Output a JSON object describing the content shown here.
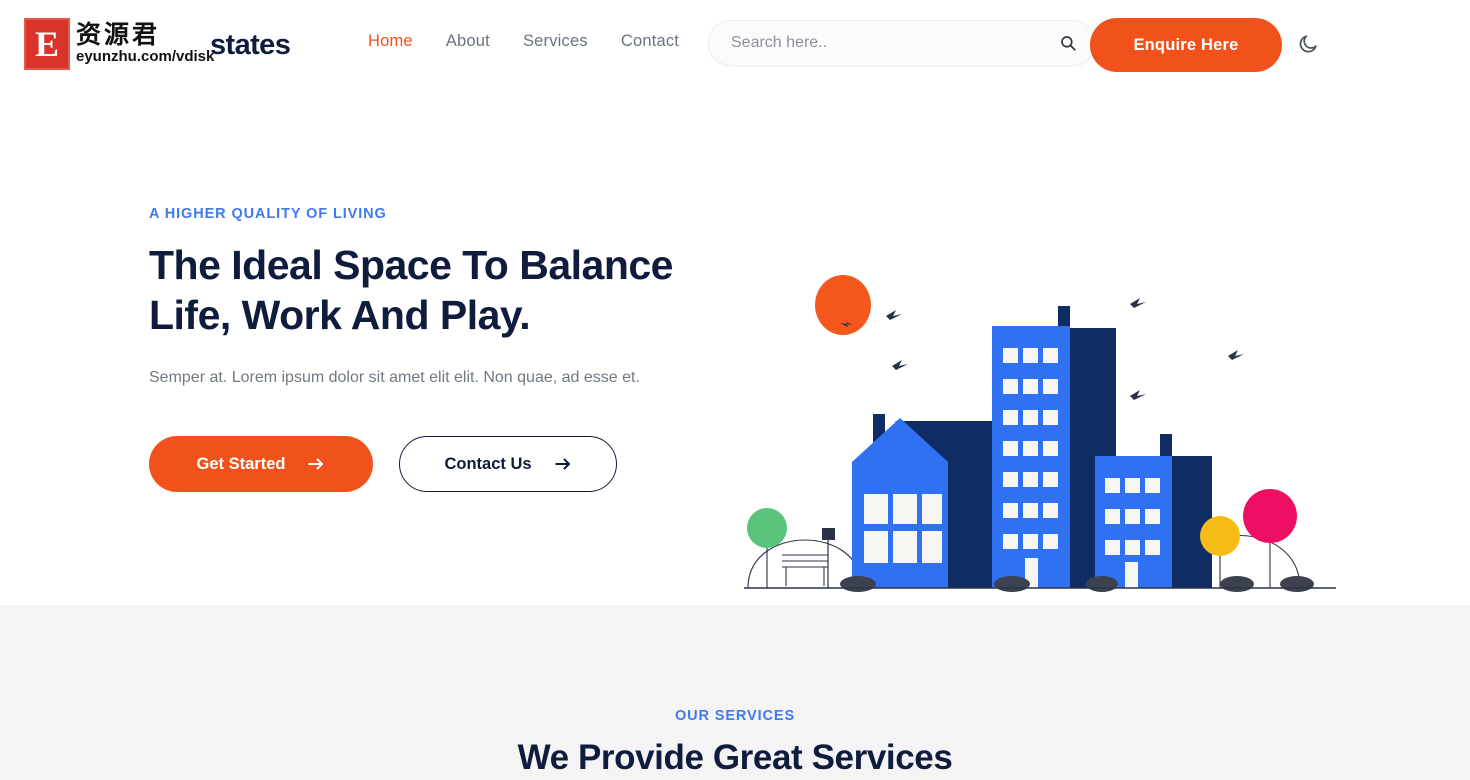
{
  "header": {
    "watermark": {
      "letter": "E",
      "chinese": "资源君",
      "url": "eyunzhu.com/vdisk"
    },
    "logo_text": "states",
    "nav": [
      {
        "label": "Home",
        "active": true
      },
      {
        "label": "About",
        "active": false
      },
      {
        "label": "Services",
        "active": false
      },
      {
        "label": "Contact",
        "active": false
      }
    ],
    "search": {
      "placeholder": "Search here..",
      "value": "",
      "icon": "search-icon"
    },
    "enquire_label": "Enquire Here",
    "theme_toggle_icon": "moon-icon"
  },
  "hero": {
    "eyebrow": "A HIGHER QUALITY OF LIVING",
    "title_line1": "The Ideal Space To Balance",
    "title_line2": "Life, Work And Play.",
    "subtitle": "Semper at. Lorem ipsum dolor sit amet elit elit. Non quae, ad esse et.",
    "primary_button": "Get Started",
    "secondary_button": "Contact Us"
  },
  "services": {
    "eyebrow": "OUR SERVICES",
    "title": "We Provide Great Services"
  },
  "colors": {
    "accent_orange": "#F1521B",
    "brand_navy": "#101C3D",
    "accent_blue": "#4079F0",
    "building_blue": "#3071F2",
    "building_navy": "#0F2C64",
    "tree_green": "#5BC47C",
    "tree_yellow": "#F5BC18",
    "tree_pink": "#EE0E62",
    "section_bg": "#F4F4F5"
  }
}
